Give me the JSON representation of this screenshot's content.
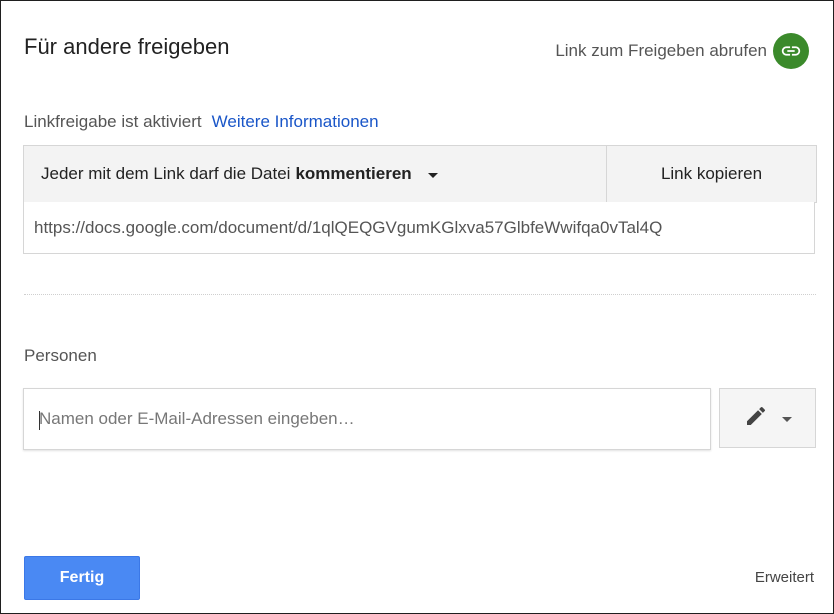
{
  "dialog": {
    "title": "Für andere freigeben",
    "get_link_label": "Link zum Freigeben abrufen",
    "link_icon": "link-icon",
    "accent_green": "#3b8a2b"
  },
  "link_sharing": {
    "status": "Linkfreigabe ist aktiviert",
    "more_info": "Weitere Informationen",
    "permission_prefix": "Jeder mit dem Link darf die Datei",
    "permission_value": "kommentieren",
    "copy_label": "Link kopieren",
    "url": "https://docs.google.com/document/d/1qlQEQGVgumKGlxva57GlbfeWwifqa0vTal4Q"
  },
  "people": {
    "label": "Personen",
    "placeholder": "Namen oder E-Mail-Adressen eingeben…",
    "role_icon": "pencil-icon"
  },
  "footer": {
    "done_label": "Fertig",
    "advanced_label": "Erweitert",
    "accent_blue": "#4a89f3"
  }
}
